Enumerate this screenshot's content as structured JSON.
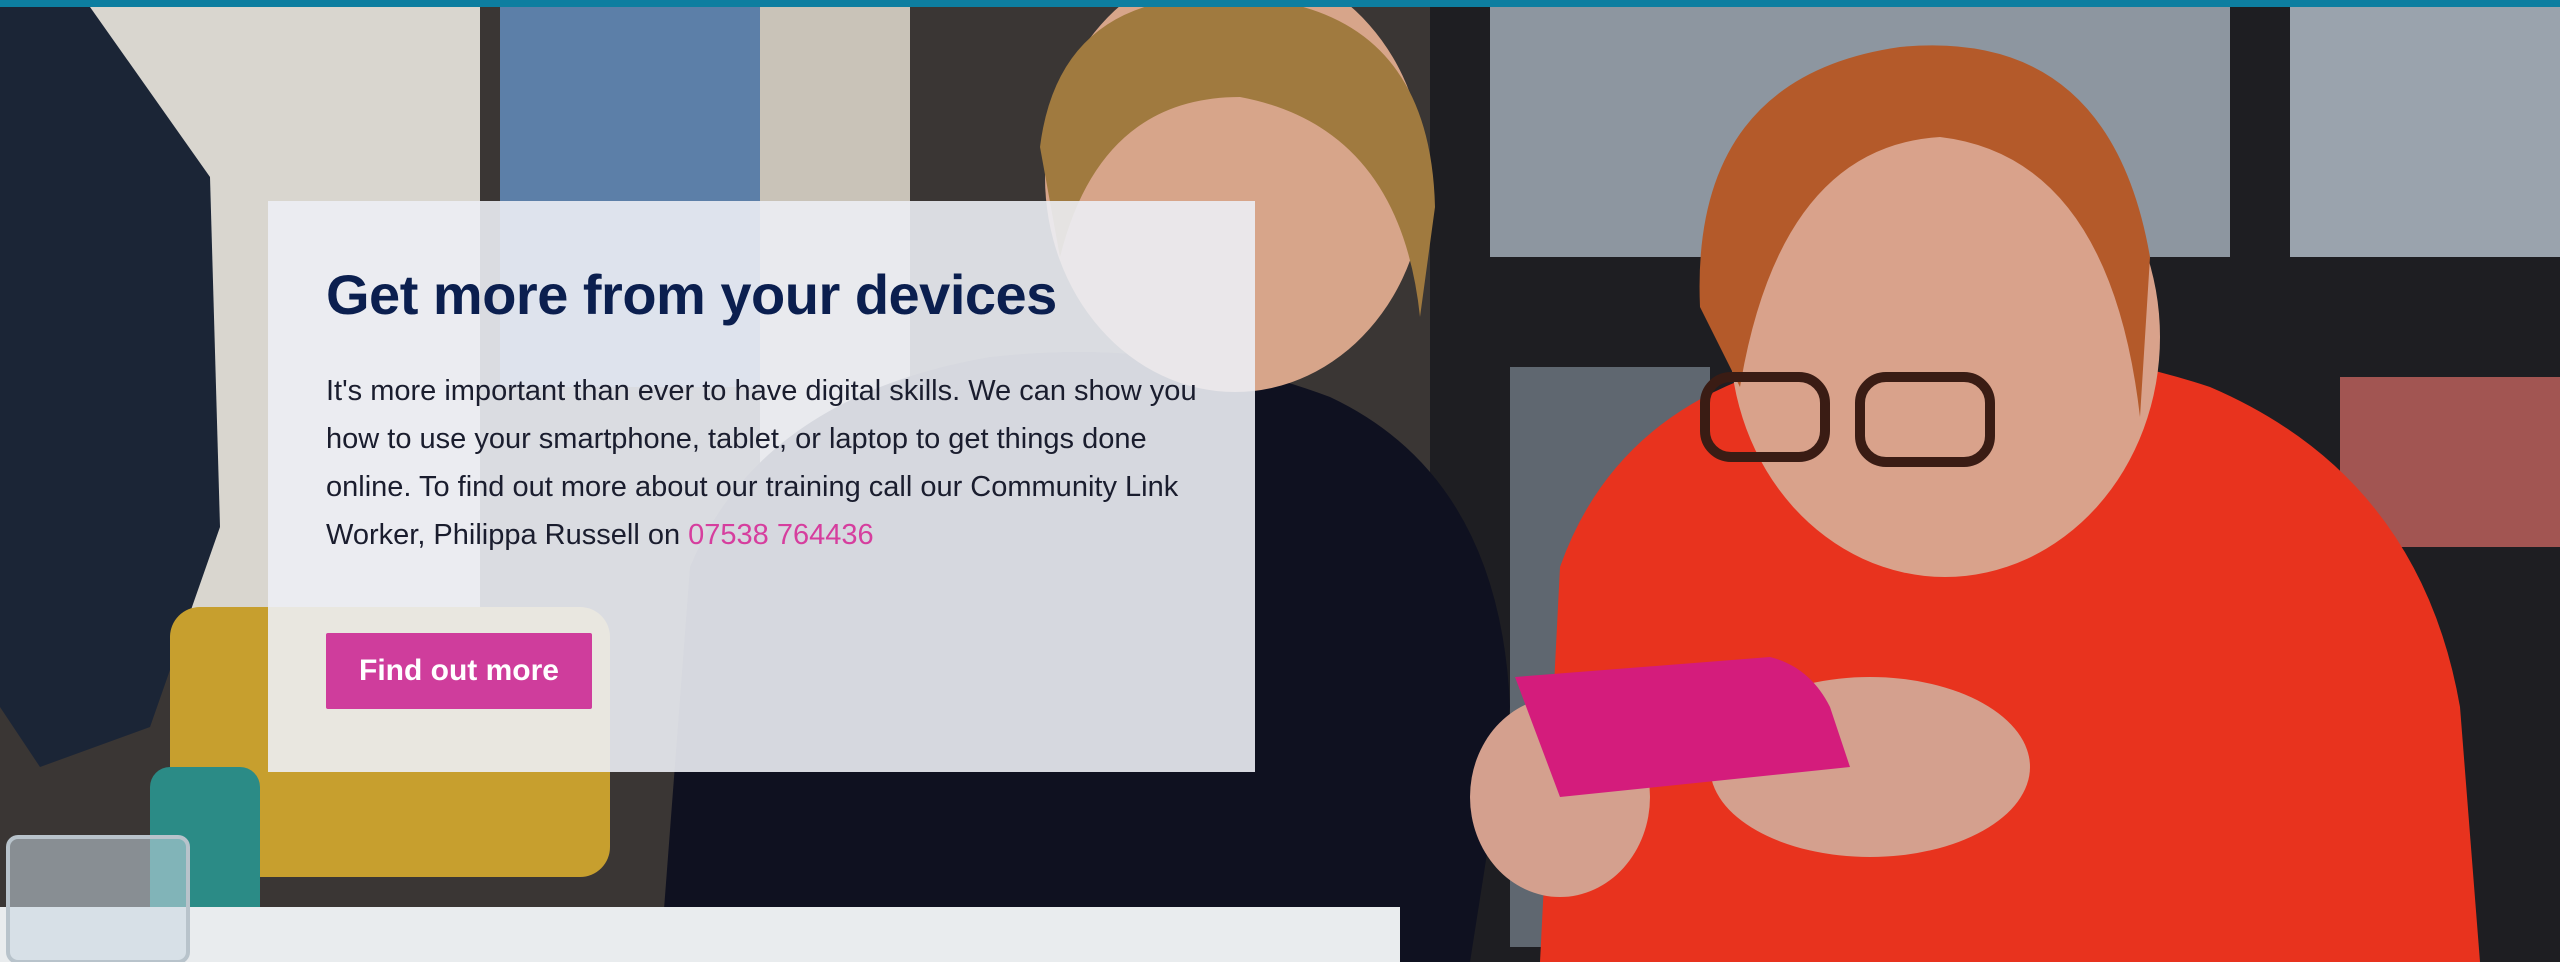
{
  "colors": {
    "top_strip": "#0d7ea0",
    "title": "#0b1f4f",
    "body_text": "#1a1d2e",
    "phone_link": "#d63e9e",
    "button_bg": "#cf3d9c",
    "button_text": "#ffffff",
    "card_bg": "rgba(236,238,244,0.90)"
  },
  "hero": {
    "photo_description_icon": "photo-two-women-with-smartphone",
    "title": "Get more from your devices",
    "body_text": "It's more important than ever to have digital skills. We can show you how to use your smartphone, tablet, or laptop to get things done online. To find out more about our training call our Community Link Worker, Philippa Russell on ",
    "phone_number": "07538 764436",
    "button_label": "Find out more"
  }
}
